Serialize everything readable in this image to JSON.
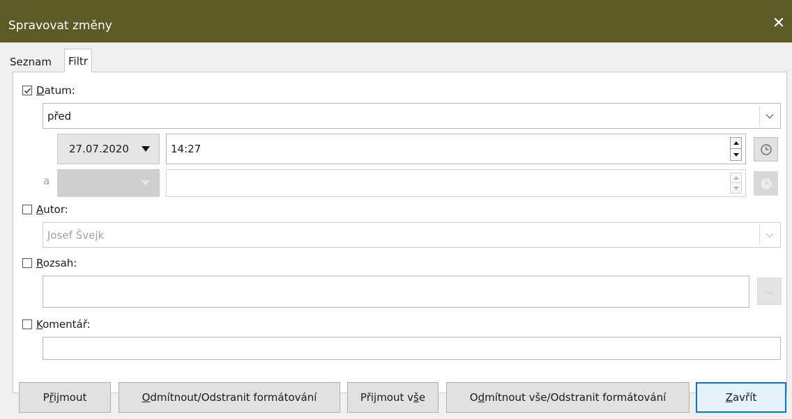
{
  "window": {
    "title": "Spravovat změny"
  },
  "tabs": [
    "Seznam",
    "Filtr"
  ],
  "filter": {
    "date": {
      "label_ul": "D",
      "label_rest": "atum:",
      "checked": true,
      "condition": "před",
      "date_value": "27.07.2020",
      "time_value": "14:27",
      "and_label": "a"
    },
    "author": {
      "label_ul": "A",
      "label_rest": "utor:",
      "checked": false,
      "value": "Josef Švejk"
    },
    "range": {
      "label_ul": "R",
      "label_rest": "ozsah:",
      "checked": false,
      "value": "",
      "browse_label": "..."
    },
    "comment": {
      "label_ul": "K",
      "label_rest": "omentář:",
      "checked": false,
      "value": ""
    }
  },
  "buttons": {
    "accept": {
      "pre": "P",
      "ul": "ř",
      "post": "ijmout"
    },
    "reject": {
      "pre": "",
      "ul": "O",
      "post": "dmítnout/Odstranit formátování"
    },
    "accept_all": {
      "pre": "Přijmout v",
      "ul": "š",
      "post": "e"
    },
    "reject_all": {
      "pre": "O",
      "ul": "d",
      "post": "mítnout vše/Odstranit formátování"
    },
    "close": {
      "pre": "",
      "ul": "Z",
      "post": "avřít"
    }
  }
}
